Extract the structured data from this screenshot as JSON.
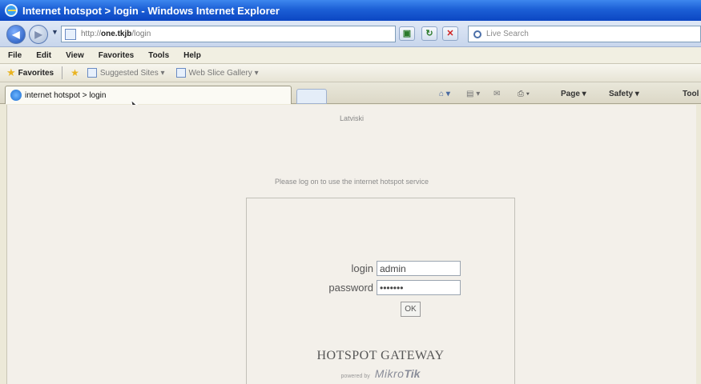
{
  "window": {
    "title": "Internet hotspot > login - Windows Internet Explorer"
  },
  "address_bar": {
    "url_prefix": "http://",
    "url_host": "one.tkjb",
    "url_path": "/login",
    "search_placeholder": "Live Search"
  },
  "menu": [
    "File",
    "Edit",
    "View",
    "Favorites",
    "Tools",
    "Help"
  ],
  "favorites_bar": {
    "label": "Favorites",
    "links": [
      "Suggested Sites ▾",
      "Web Slice Gallery ▾"
    ]
  },
  "tab": {
    "title": "internet hotspot > login"
  },
  "command_bar": {
    "page": "Page ▾",
    "safety": "Safety ▾",
    "tools": "Tool"
  },
  "page": {
    "language": "Latviski",
    "prompt": "Please log on to use the internet hotspot service",
    "login_label": "login",
    "login_value": "admin",
    "password_label": "password",
    "password_value": "admin12",
    "ok_label": "OK",
    "gateway_title": "HOTSPOT GATEWAY",
    "powered_by": "powered by",
    "brand_part1": "Mikro",
    "brand_part2": "Tik"
  }
}
